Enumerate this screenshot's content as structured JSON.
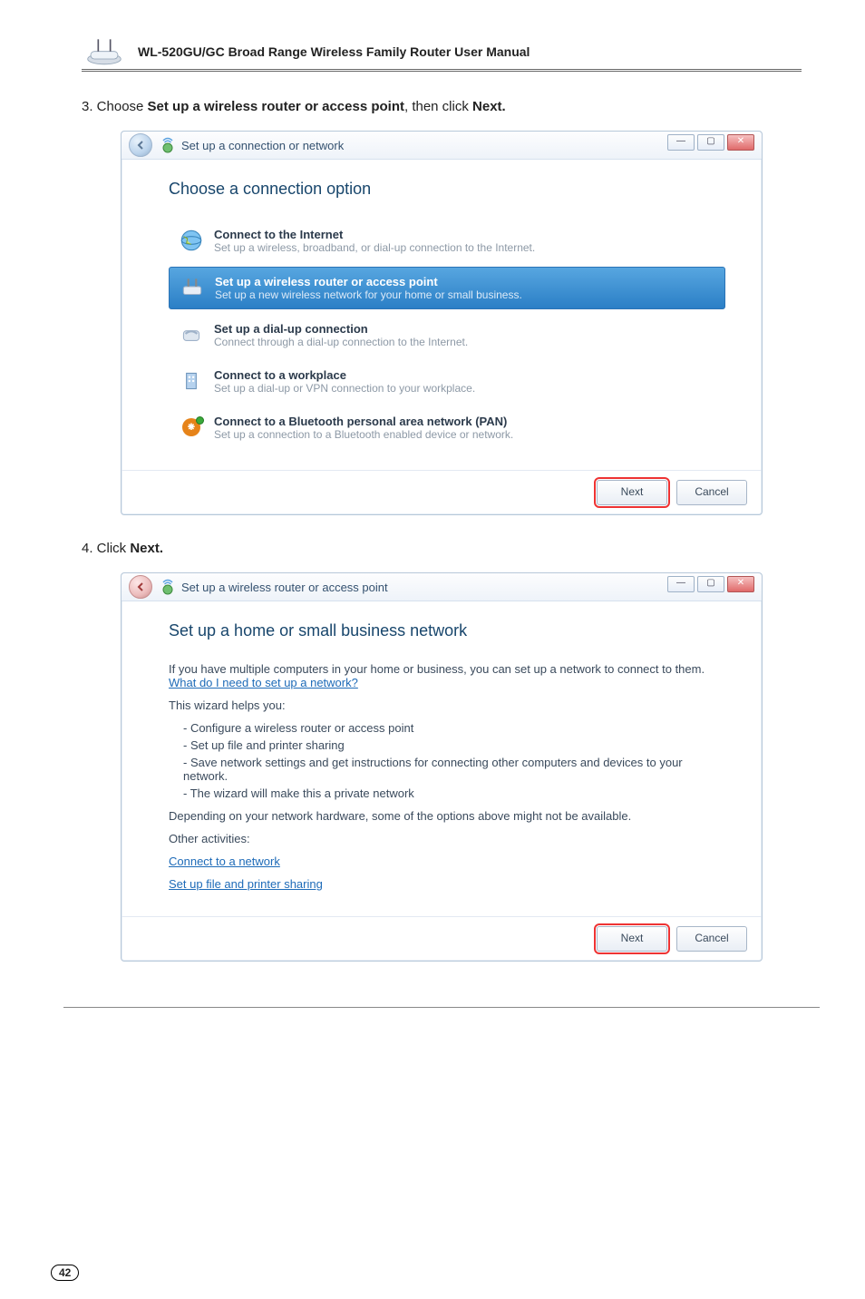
{
  "header": {
    "manual_title": "WL-520GU/GC Broad Range Wireless Family Router User Manual"
  },
  "step3": {
    "prefix": "3. Choose ",
    "bold": "Set up a wireless router or access point",
    "mid": ", then click ",
    "bold2": "Next."
  },
  "step4": {
    "prefix": "4. Click ",
    "bold": "Next."
  },
  "dialog1": {
    "title": "Set up a connection or network",
    "heading": "Choose a connection option",
    "options": [
      {
        "title": "Connect to the Internet",
        "desc": "Set up a wireless, broadband, or dial-up connection to the Internet."
      },
      {
        "title": "Set up a wireless router or access point",
        "desc": "Set up a new wireless network for your home or small business."
      },
      {
        "title": "Set up a dial-up connection",
        "desc": "Connect through a dial-up connection to the Internet."
      },
      {
        "title": "Connect to a workplace",
        "desc": "Set up a dial-up or VPN connection to your workplace."
      },
      {
        "title": "Connect to a Bluetooth personal area network (PAN)",
        "desc": "Set up a connection to a Bluetooth enabled device or network."
      }
    ],
    "buttons": {
      "next": "Next",
      "cancel": "Cancel"
    }
  },
  "dialog2": {
    "title": "Set up a wireless router or access point",
    "heading": "Set up a home or small business network",
    "intro": "If you have multiple computers in your home or business, you can set up a network to connect to them.  ",
    "intro_link": "What do I need to set up a network?",
    "helps": "This wizard helps you:",
    "bullets": [
      "- Configure a wireless router or access point",
      "- Set up file and printer sharing",
      "- Save network settings and get instructions for connecting other computers and devices to your network.",
      "- The wizard will make this a private network"
    ],
    "depends": "Depending on your network hardware, some of the options above might not be available.",
    "other": "Other activities:",
    "link1": "Connect to a network",
    "link2": "Set up file and printer sharing",
    "buttons": {
      "next": "Next",
      "cancel": "Cancel"
    }
  },
  "page_number": "42"
}
